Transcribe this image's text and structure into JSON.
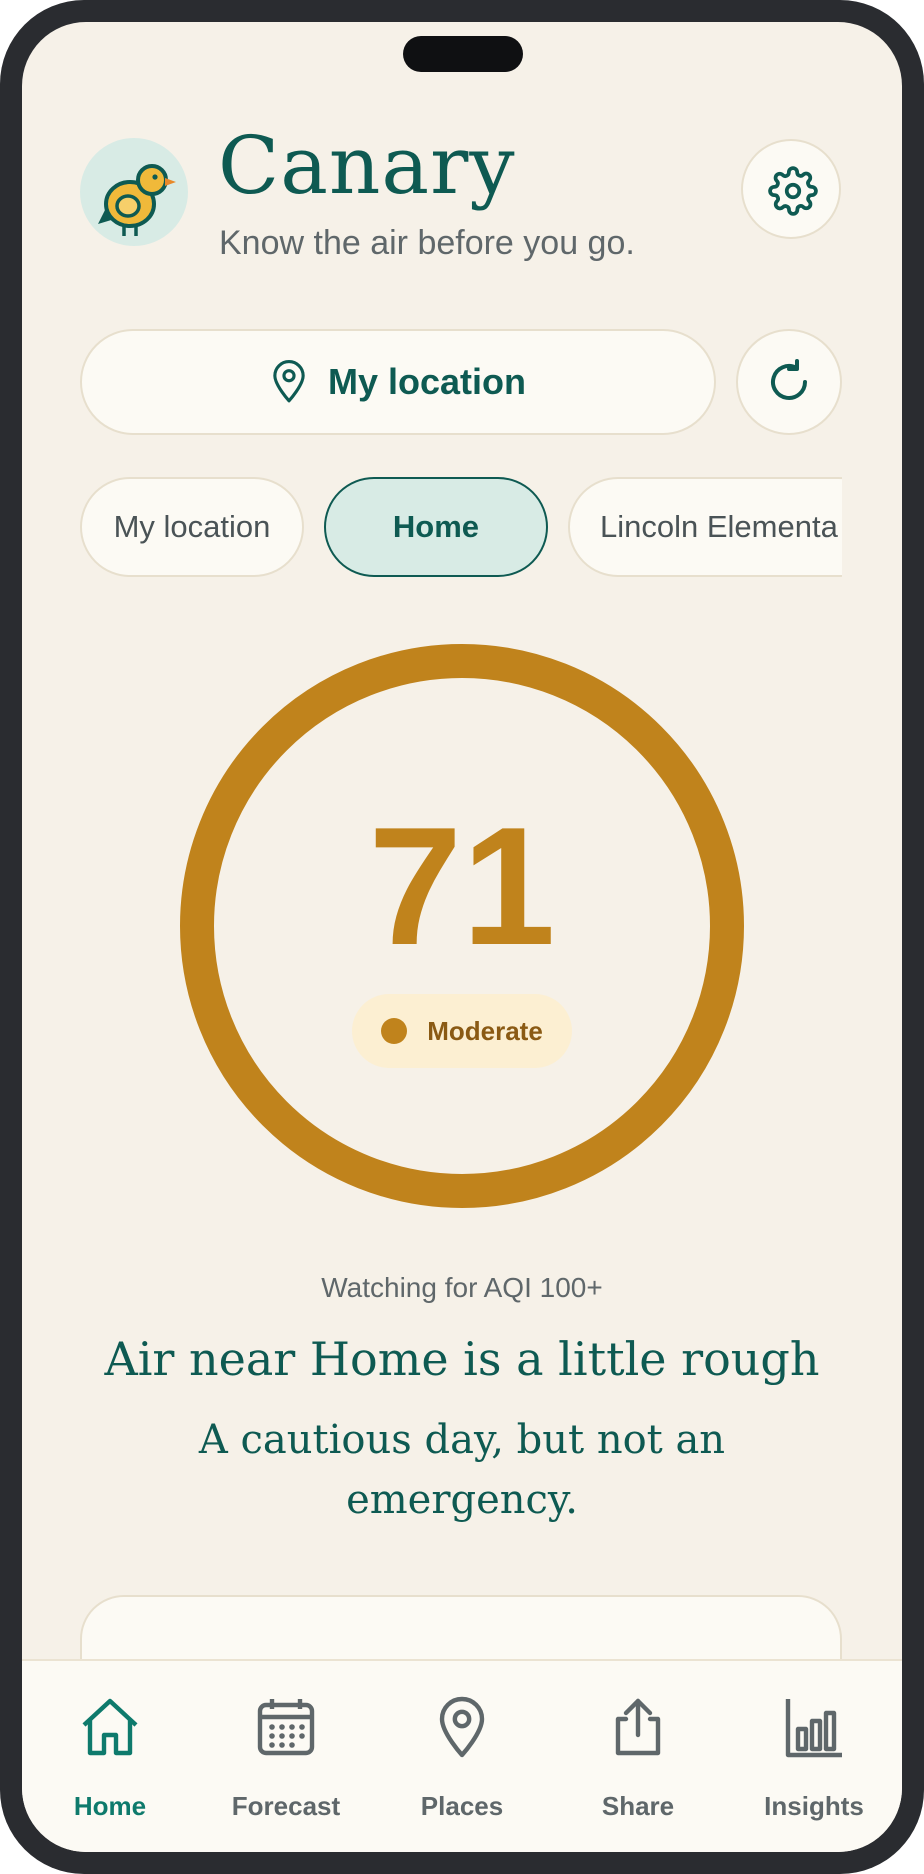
{
  "app": {
    "title": "Canary",
    "subtitle": "Know the air before you go."
  },
  "location": {
    "button_label": "My location"
  },
  "chips": [
    {
      "label": "My location",
      "active": false
    },
    {
      "label": "Home",
      "active": true
    },
    {
      "label": "Lincoln Elementa",
      "active": false
    }
  ],
  "aqi": {
    "value": "71",
    "category": "Moderate",
    "level_fraction": 1.0,
    "color": "#c0831c"
  },
  "summary": {
    "watching": "Watching for AQI 100+",
    "headline": "Air near Home is a little rough",
    "subhead": "A cautious day, but not an emergency."
  },
  "nav": [
    {
      "label": "Home",
      "icon": "home-icon",
      "active": true
    },
    {
      "label": "Forecast",
      "icon": "calendar-icon",
      "active": false
    },
    {
      "label": "Places",
      "icon": "map-pin-icon",
      "active": false
    },
    {
      "label": "Share",
      "icon": "share-icon",
      "active": false
    },
    {
      "label": "Insights",
      "icon": "bar-chart-icon",
      "active": false
    }
  ],
  "colors": {
    "brand": "#0e5a52",
    "accent_nav": "#0e7a6c",
    "background": "#f6f1e8",
    "moderate": "#c0831c"
  }
}
